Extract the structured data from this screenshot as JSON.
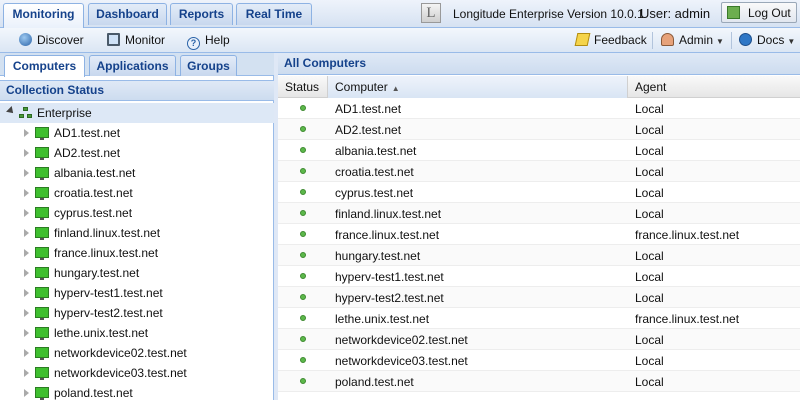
{
  "top_tabs": [
    {
      "label": "Monitoring",
      "active": true
    },
    {
      "label": "Dashboard",
      "active": false
    },
    {
      "label": "Reports",
      "active": false
    },
    {
      "label": "Real Time",
      "active": false
    }
  ],
  "header": {
    "logo_glyph": "L",
    "version_text": "Longitude Enterprise Version 10.0.1",
    "user_text": "User: admin",
    "logout_label": "Log Out"
  },
  "toolbar": {
    "discover": "Discover",
    "monitor": "Monitor",
    "help": "Help",
    "feedback": "Feedback",
    "admin": "Admin",
    "docs": "Docs"
  },
  "left_tabs": [
    {
      "label": "Computers",
      "active": true
    },
    {
      "label": "Applications",
      "active": false
    },
    {
      "label": "Groups",
      "active": false
    }
  ],
  "collection_status": {
    "title": "Collection Status",
    "root": "Enterprise",
    "nodes": [
      "AD1.test.net",
      "AD2.test.net",
      "albania.test.net",
      "croatia.test.net",
      "cyprus.test.net",
      "finland.linux.test.net",
      "france.linux.test.net",
      "hungary.test.net",
      "hyperv-test1.test.net",
      "hyperv-test2.test.net",
      "lethe.unix.test.net",
      "networkdevice02.test.net",
      "networkdevice03.test.net",
      "poland.test.net"
    ]
  },
  "all_computers": {
    "title": "All Computers",
    "columns": {
      "status": "Status",
      "computer": "Computer",
      "agent": "Agent"
    },
    "rows": [
      {
        "computer": "AD1.test.net",
        "agent": "Local"
      },
      {
        "computer": "AD2.test.net",
        "agent": "Local"
      },
      {
        "computer": "albania.test.net",
        "agent": "Local"
      },
      {
        "computer": "croatia.test.net",
        "agent": "Local"
      },
      {
        "computer": "cyprus.test.net",
        "agent": "Local"
      },
      {
        "computer": "finland.linux.test.net",
        "agent": "Local"
      },
      {
        "computer": "france.linux.test.net",
        "agent": "france.linux.test.net"
      },
      {
        "computer": "hungary.test.net",
        "agent": "Local"
      },
      {
        "computer": "hyperv-test1.test.net",
        "agent": "Local"
      },
      {
        "computer": "hyperv-test2.test.net",
        "agent": "Local"
      },
      {
        "computer": "lethe.unix.test.net",
        "agent": "france.linux.test.net"
      },
      {
        "computer": "networkdevice02.test.net",
        "agent": "Local"
      },
      {
        "computer": "networkdevice03.test.net",
        "agent": "Local"
      },
      {
        "computer": "poland.test.net",
        "agent": "Local"
      }
    ]
  },
  "colors": {
    "accent": "#15428b",
    "status_ok": "#5cb84a",
    "panel_border": "#99bbe8"
  }
}
